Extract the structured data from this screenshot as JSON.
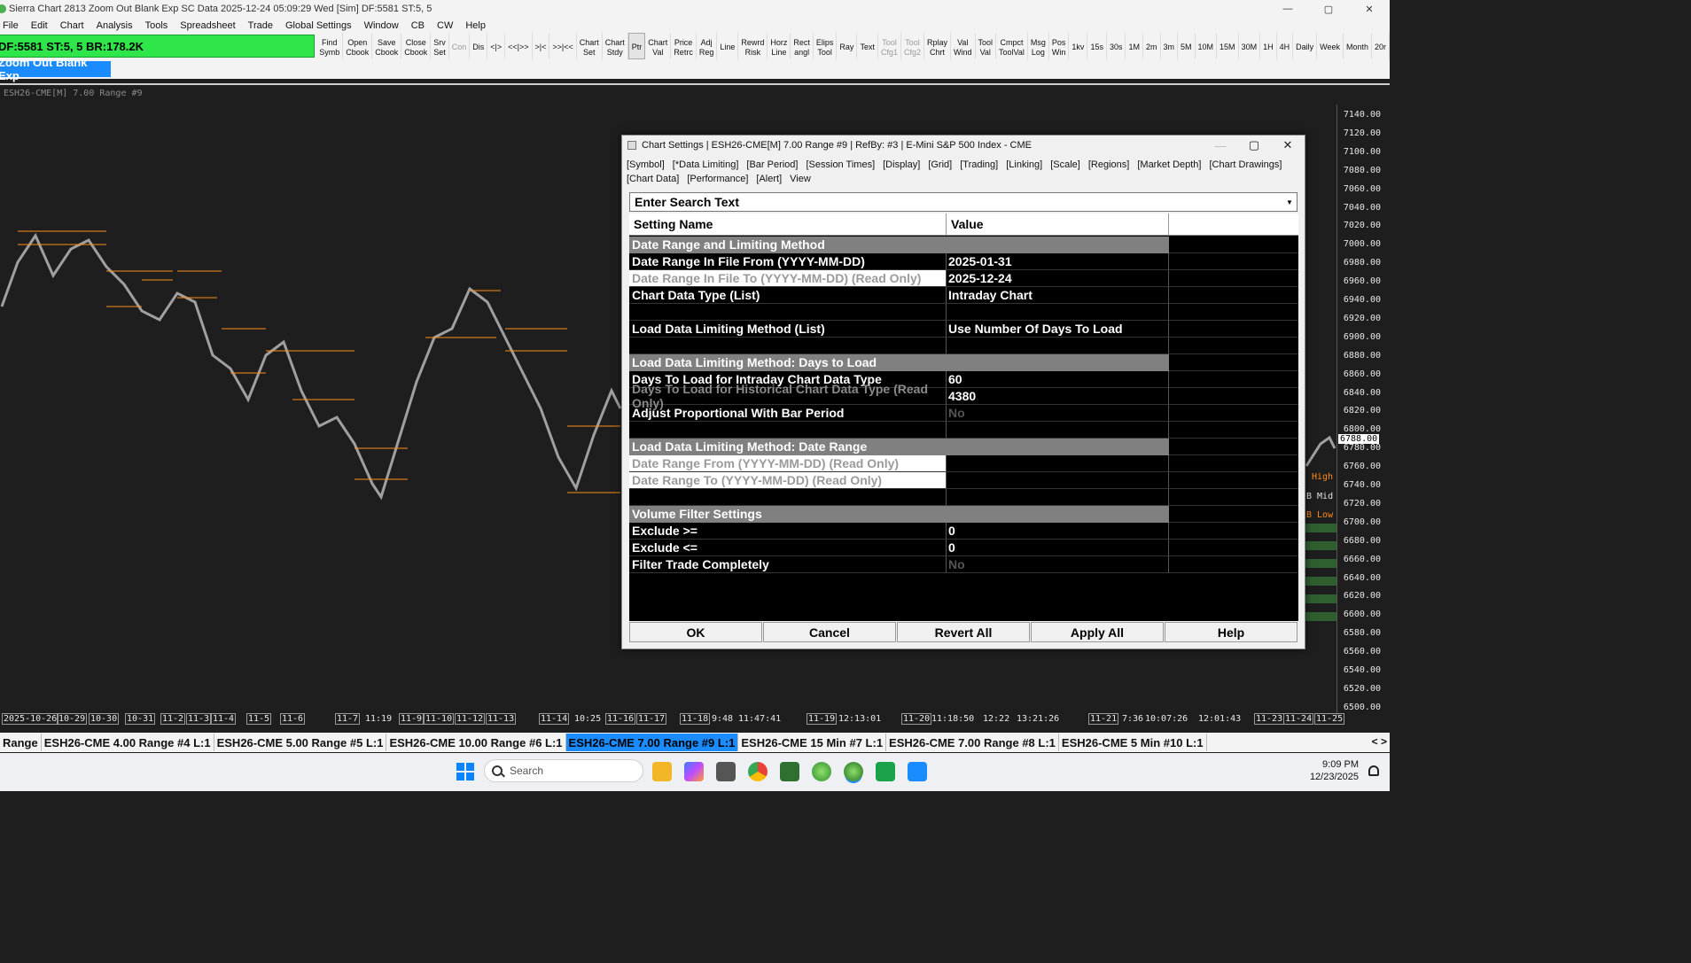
{
  "window": {
    "title": "Sierra Chart 2813 Zoom Out Blank Exp SC Data 2025-12-24  05:09:29 Wed [Sim] DF:5581  ST:5, 5",
    "controls": [
      "—",
      "▢",
      "✕"
    ]
  },
  "menu": [
    "File",
    "Edit",
    "Chart",
    "Analysis",
    "Tools",
    "Spreadsheet",
    "Trade",
    "Global Settings",
    "Window",
    "CB",
    "CW",
    "Help"
  ],
  "toolbar": {
    "status": "DF:5581  ST:5, 5  BR:178.2K",
    "buttons": [
      {
        "l1": "Find",
        "l2": "Symb"
      },
      {
        "l1": "Open",
        "l2": "Cbook"
      },
      {
        "l1": "Save",
        "l2": "Cbook"
      },
      {
        "l1": "Close",
        "l2": "Cbook"
      },
      {
        "l1": "Srv",
        "l2": "Set"
      },
      {
        "l1": "Con",
        "l2": "",
        "disabled": true
      },
      {
        "l1": "Dis",
        "l2": ""
      },
      {
        "l1": "<|>",
        "l2": ""
      },
      {
        "l1": "<<|>>",
        "l2": ""
      },
      {
        "l1": ">|<",
        "l2": ""
      },
      {
        "l1": ">>|<<",
        "l2": ""
      },
      {
        "l1": "Chart",
        "l2": "Set"
      },
      {
        "l1": "Chart",
        "l2": "Stdy"
      },
      {
        "l1": "Ptr",
        "l2": "",
        "active": true
      },
      {
        "l1": "Chart",
        "l2": "Val"
      },
      {
        "l1": "Price",
        "l2": "Retrc"
      },
      {
        "l1": "Adj",
        "l2": "Reg"
      },
      {
        "l1": "Line",
        "l2": ""
      },
      {
        "l1": "Rewrd",
        "l2": "Risk"
      },
      {
        "l1": "Horz",
        "l2": "Line"
      },
      {
        "l1": "Rect",
        "l2": "angl"
      },
      {
        "l1": "Elips",
        "l2": "Tool"
      },
      {
        "l1": "Ray",
        "l2": ""
      },
      {
        "l1": "Text",
        "l2": ""
      },
      {
        "l1": "Tool",
        "l2": "Cfg1",
        "disabled": true
      },
      {
        "l1": "Tool",
        "l2": "Cfg2",
        "disabled": true
      },
      {
        "l1": "Rplay",
        "l2": "Chrt"
      },
      {
        "l1": "Val",
        "l2": "Wind"
      },
      {
        "l1": "Tool",
        "l2": "Val"
      },
      {
        "l1": "Cmpct",
        "l2": "ToolVal"
      },
      {
        "l1": "Msg",
        "l2": "Log"
      },
      {
        "l1": "Pos",
        "l2": "Win"
      },
      {
        "l1": "1kv",
        "l2": ""
      },
      {
        "l1": "15s",
        "l2": ""
      },
      {
        "l1": "30s",
        "l2": ""
      },
      {
        "l1": "1M",
        "l2": ""
      },
      {
        "l1": "2m",
        "l2": ""
      },
      {
        "l1": "3m",
        "l2": ""
      },
      {
        "l1": "5M",
        "l2": ""
      },
      {
        "l1": "10M",
        "l2": ""
      },
      {
        "l1": "15M",
        "l2": ""
      },
      {
        "l1": "30M",
        "l2": ""
      },
      {
        "l1": "1H",
        "l2": ""
      },
      {
        "l1": "4H",
        "l2": ""
      },
      {
        "l1": "Daily",
        "l2": ""
      },
      {
        "l1": "Week",
        "l2": ""
      },
      {
        "l1": "Month",
        "l2": ""
      },
      {
        "l1": "20r",
        "l2": ""
      }
    ]
  },
  "cbook_label": "Zoom Out Blank Exp",
  "chart": {
    "label": "ESH26-CME[M]  7.00 Range #9",
    "y_ticks": [
      "7140.00",
      "7120.00",
      "7100.00",
      "7080.00",
      "7060.00",
      "7040.00",
      "7020.00",
      "7000.00",
      "6980.00",
      "6960.00",
      "6940.00",
      "6920.00",
      "6900.00",
      "6880.00",
      "6860.00",
      "6840.00",
      "6820.00",
      "6800.00",
      "6780.00",
      "6760.00",
      "6740.00",
      "6720.00",
      "6700.00",
      "6680.00",
      "6660.00",
      "6640.00",
      "6620.00",
      "6600.00",
      "6580.00",
      "6560.00",
      "6540.00",
      "6520.00",
      "6500.00"
    ],
    "price_tag": "6788.00",
    "side_labels": {
      "high": "High",
      "mid": "B Mid",
      "low": "B Low"
    },
    "x_ticks": [
      {
        "t": "2025-10-26",
        "b": true
      },
      {
        "t": "10-29",
        "b": true
      },
      {
        "t": "10-30",
        "b": true
      },
      {
        "t": "10-31",
        "b": true
      },
      {
        "t": "11-2",
        "b": true
      },
      {
        "t": "11-3",
        "b": true
      },
      {
        "t": "11-4",
        "b": true
      },
      {
        "t": "11-5",
        "b": true
      },
      {
        "t": "11-6",
        "b": true
      },
      {
        "t": "11-7",
        "b": true
      },
      {
        "t": "11:19",
        "b": false
      },
      {
        "t": "11-9",
        "b": true
      },
      {
        "t": "11-10",
        "b": true
      },
      {
        "t": "11-12",
        "b": true
      },
      {
        "t": "11-13",
        "b": true
      },
      {
        "t": "11-14",
        "b": true
      },
      {
        "t": "10:25",
        "b": false
      },
      {
        "t": "11-16",
        "b": true
      },
      {
        "t": "11-17",
        "b": true
      },
      {
        "t": "11-18",
        "b": true
      },
      {
        "t": "9:48",
        "b": false
      },
      {
        "t": "11:47:41",
        "b": false
      },
      {
        "t": "11-19",
        "b": true
      },
      {
        "t": "12:13:01",
        "b": false
      },
      {
        "t": "11-20",
        "b": true
      },
      {
        "t": "11:18:50",
        "b": false
      },
      {
        "t": "12:22",
        "b": false
      },
      {
        "t": "13:21:26",
        "b": false
      },
      {
        "t": "11-21",
        "b": true
      },
      {
        "t": "7:36",
        "b": false
      },
      {
        "t": "10:07:26",
        "b": false
      },
      {
        "t": "12:01:43",
        "b": false
      },
      {
        "t": "11-23",
        "b": true
      },
      {
        "t": "11-24",
        "b": true
      },
      {
        "t": "11-25",
        "b": true
      }
    ]
  },
  "tabs": [
    {
      "label": "Range",
      "active": false
    },
    {
      "label": "ESH26-CME  4.00 Range #4 L:1",
      "active": false
    },
    {
      "label": "ESH26-CME  5.00 Range #5 L:1",
      "active": false
    },
    {
      "label": "ESH26-CME  10.00 Range #6 L:1",
      "active": false
    },
    {
      "label": "ESH26-CME  7.00 Range #9 L:1",
      "active": true
    },
    {
      "label": "ESH26-CME  15 Min  #7 L:1",
      "active": false
    },
    {
      "label": "ESH26-CME  7.00 Range #8 L:1",
      "active": false
    },
    {
      "label": "ESH26-CME  5 Min  #10 L:1",
      "active": false
    }
  ],
  "tab_arrows": "< >",
  "taskbar": {
    "search_placeholder": "Search",
    "time": "9:09 PM",
    "date": "12/23/2025"
  },
  "dialog": {
    "title": "Chart Settings | ESH26-CME[M]  7.00 Range #9 | RefBy: #3 | E-Mini S&P 500 Index - CME",
    "tabs": [
      "[Symbol]",
      "[*Data Limiting]",
      "[Bar Period]",
      "[Session Times]",
      "[Display]",
      "[Grid]",
      "[Trading]",
      "[Linking]",
      "[Scale]",
      "[Regions]",
      "[Market Depth]",
      "[Chart Drawings]",
      "[Chart Data]",
      "[Performance]",
      "[Alert]",
      "View"
    ],
    "search_text": "Enter Search Text",
    "col_name": "Setting Name",
    "col_value": "Value",
    "rows": [
      {
        "type": "section",
        "name": "Date Range and Limiting Method",
        "value": ""
      },
      {
        "type": "normal",
        "name": "Date Range In File From (YYYY-MM-DD)",
        "value": "2025-01-31"
      },
      {
        "type": "ro",
        "name": "Date Range In File To (YYYY-MM-DD) (Read Only)",
        "value": "2025-12-24"
      },
      {
        "type": "normal",
        "name": "Chart Data Type (List)",
        "value": "Intraday Chart"
      },
      {
        "type": "blank",
        "name": "",
        "value": ""
      },
      {
        "type": "normal",
        "name": "Load Data Limiting Method (List)",
        "value": "Use Number Of Days To Load"
      },
      {
        "type": "blank",
        "name": "",
        "value": ""
      },
      {
        "type": "section",
        "name": "Load Data Limiting Method: Days to Load",
        "value": ""
      },
      {
        "type": "normal",
        "name": "Days To Load for Intraday Chart Data Type",
        "value": "60"
      },
      {
        "type": "greyname",
        "name": "Days To Load for Historical Chart Data Type (Read Only)",
        "value": "4380"
      },
      {
        "type": "normal",
        "name": "Adjust Proportional With Bar Period",
        "value": "No",
        "dim": true
      },
      {
        "type": "blank",
        "name": "",
        "value": ""
      },
      {
        "type": "section",
        "name": "Load Data Limiting Method: Date Range",
        "value": ""
      },
      {
        "type": "ro",
        "name": "Date Range From (YYYY-MM-DD) (Read Only)",
        "value": ""
      },
      {
        "type": "ro",
        "name": "Date Range To (YYYY-MM-DD) (Read Only)",
        "value": ""
      },
      {
        "type": "blank",
        "name": "",
        "value": ""
      },
      {
        "type": "section",
        "name": "Volume Filter Settings",
        "value": ""
      },
      {
        "type": "normal",
        "name": "Exclude >=",
        "value": "0"
      },
      {
        "type": "normal",
        "name": "Exclude <=",
        "value": "0"
      },
      {
        "type": "normal",
        "name": "Filter Trade Completely",
        "value": "No",
        "dim": true
      }
    ],
    "buttons": [
      "OK",
      "Cancel",
      "Revert All",
      "Apply All",
      "Help"
    ]
  }
}
